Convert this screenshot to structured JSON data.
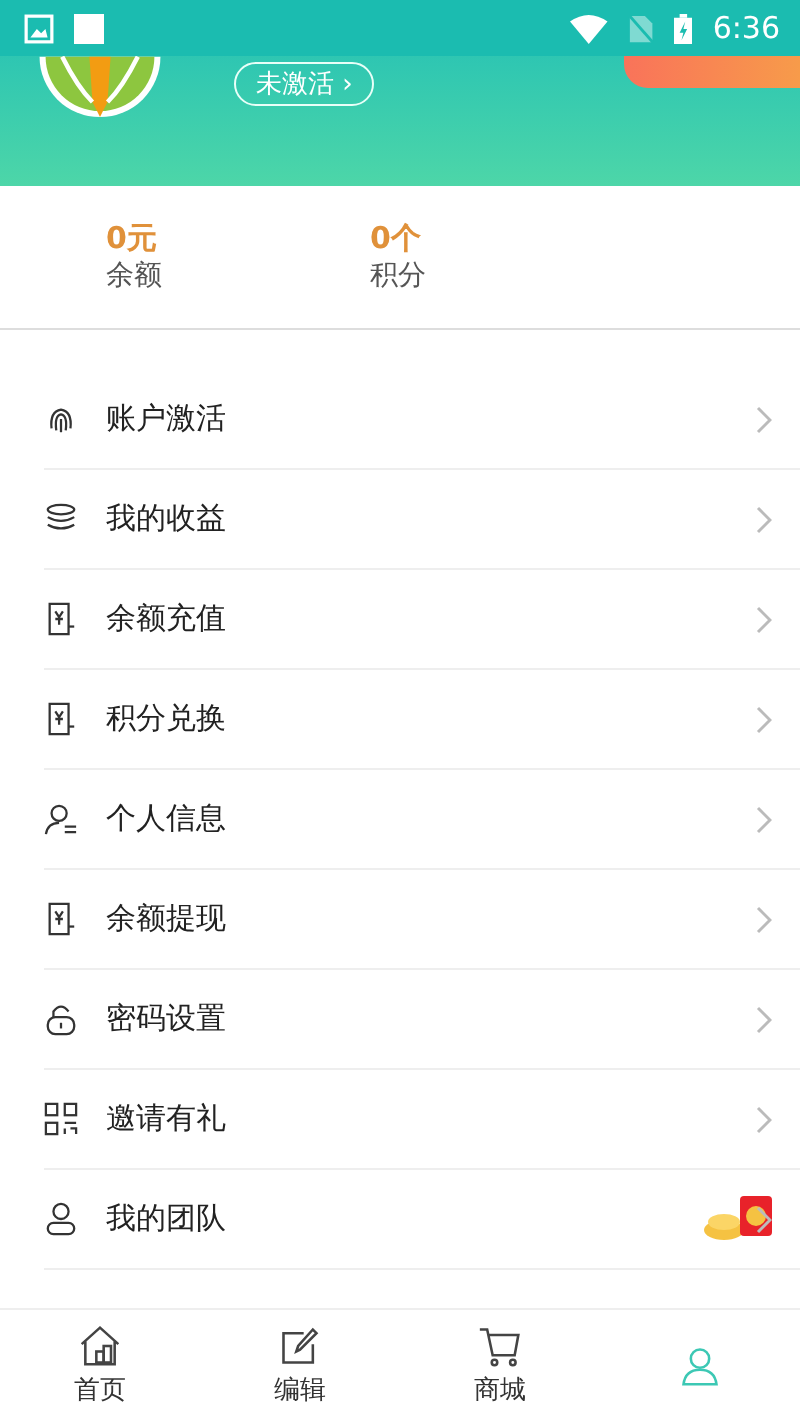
{
  "status_bar": {
    "time": "6:36"
  },
  "header": {
    "status_button": "未激活 ›"
  },
  "stats": [
    {
      "value": "0元",
      "label": "余额"
    },
    {
      "value": "0个",
      "label": "积分"
    }
  ],
  "menu": [
    {
      "kind": "fingerprint",
      "label": "账户激活",
      "promo": false
    },
    {
      "kind": "coins",
      "label": "我的收益",
      "promo": false
    },
    {
      "kind": "receipt",
      "label": "余额充值",
      "promo": false
    },
    {
      "kind": "receipt",
      "label": "积分兑换",
      "promo": false
    },
    {
      "kind": "profile",
      "label": "个人信息",
      "promo": false
    },
    {
      "kind": "receipt",
      "label": "余额提现",
      "promo": false
    },
    {
      "kind": "lock",
      "label": "密码设置",
      "promo": false
    },
    {
      "kind": "qr",
      "label": "邀请有礼",
      "promo": false
    },
    {
      "kind": "person",
      "label": "我的团队",
      "promo": true
    }
  ],
  "tabs": [
    {
      "kind": "home",
      "label": "首页",
      "selected": false
    },
    {
      "kind": "edit",
      "label": "编辑",
      "selected": false
    },
    {
      "kind": "cart",
      "label": "商城",
      "selected": false
    },
    {
      "kind": "person",
      "selected": true
    }
  ]
}
